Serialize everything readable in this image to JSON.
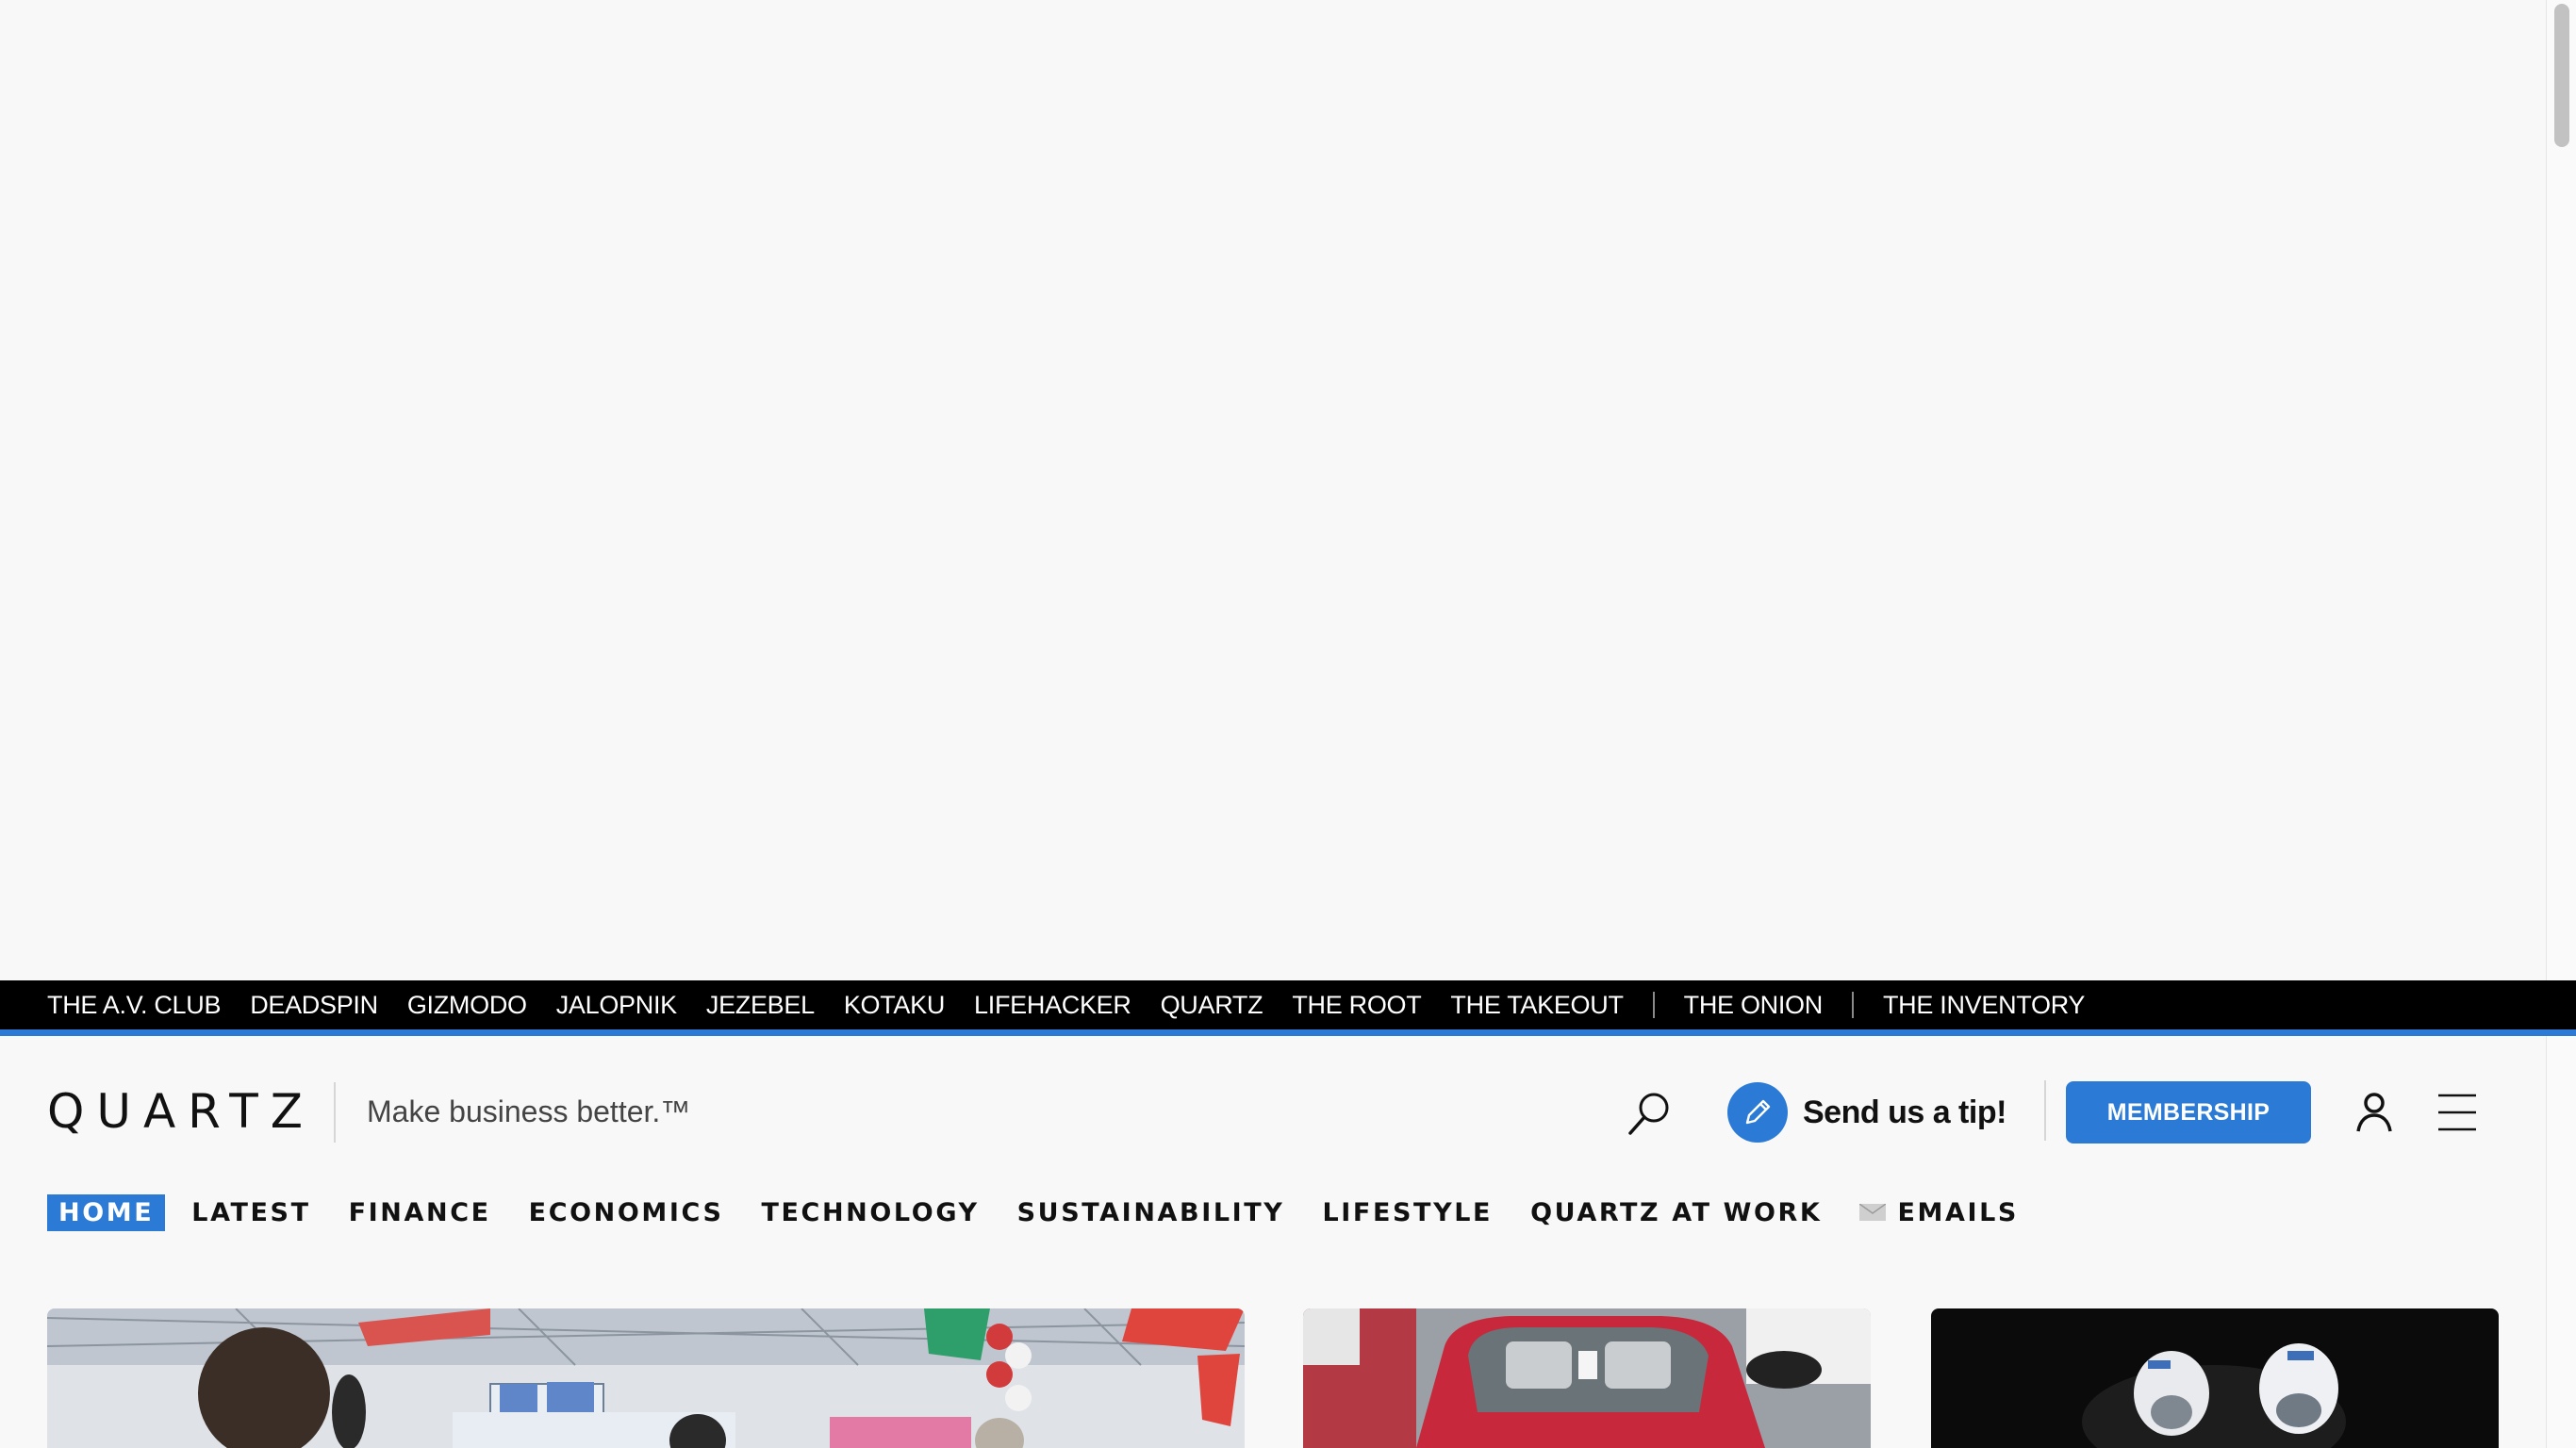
{
  "network": {
    "sites": [
      "THE A.V. CLUB",
      "DEADSPIN",
      "GIZMODO",
      "JALOPNIK",
      "JEZEBEL",
      "KOTAKU",
      "LIFEHACKER",
      "QUARTZ",
      "THE ROOT",
      "THE TAKEOUT"
    ],
    "extra1": "THE ONION",
    "extra2": "THE INVENTORY"
  },
  "header": {
    "logo": "QUARTZ",
    "tagline": "Make business better.™",
    "tip_label": "Send us a tip!",
    "membership_label": "MEMBERSHIP"
  },
  "nav": {
    "items": [
      "HOME",
      "LATEST",
      "FINANCE",
      "ECONOMICS",
      "TECHNOLOGY",
      "SUSTAINABILITY",
      "LIFESTYLE",
      "QUARTZ AT WORK"
    ],
    "emails": "EMAILS"
  },
  "colors": {
    "accent": "#2b7bd6",
    "network_bg": "#000000",
    "page_bg": "#f8f8f8"
  },
  "icons": [
    "search-icon",
    "pencil-icon",
    "user-icon",
    "hamburger-icon",
    "mail-icon"
  ]
}
